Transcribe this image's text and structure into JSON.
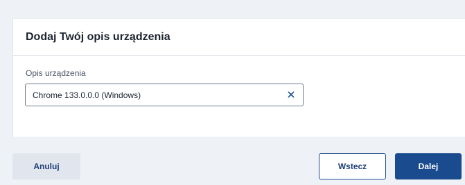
{
  "card": {
    "title": "Dodaj Twój opis urządzenia"
  },
  "field": {
    "label": "Opis urządzenia",
    "value": "Chrome 133.0.0.0 (Windows)",
    "clear_icon": "close-icon"
  },
  "footer": {
    "cancel_label": "Anuluj",
    "back_label": "Wstecz",
    "next_label": "Dalej"
  },
  "colors": {
    "primary": "#1a4b8f",
    "clear_icon": "#2c5aa0",
    "background": "#eef1f5"
  }
}
